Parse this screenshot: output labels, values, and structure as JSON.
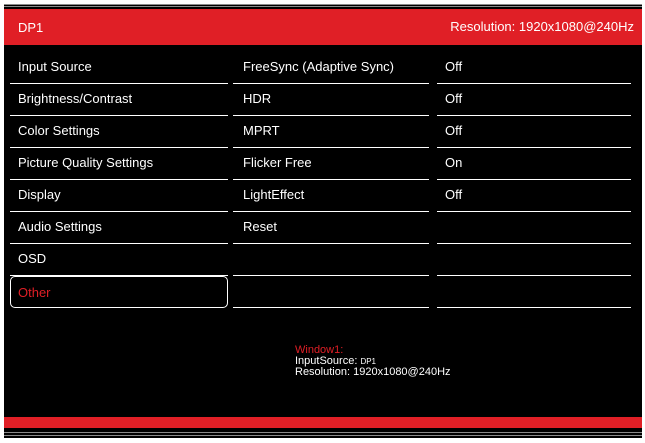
{
  "header": {
    "title": "DP1",
    "resolution": "Resolution: 1920x1080@240Hz"
  },
  "menu": {
    "items": [
      {
        "label": "Input Source"
      },
      {
        "label": "Brightness/Contrast"
      },
      {
        "label": "Color Settings"
      },
      {
        "label": "Picture Quality Settings"
      },
      {
        "label": "Display"
      },
      {
        "label": "Audio Settings"
      },
      {
        "label": "OSD"
      },
      {
        "label": "Other",
        "selected": true
      }
    ]
  },
  "submenu": {
    "items": [
      {
        "label": "FreeSync (Adaptive Sync)",
        "value": "Off"
      },
      {
        "label": "HDR",
        "value": "Off"
      },
      {
        "label": "MPRT",
        "value": "Off"
      },
      {
        "label": "Flicker Free",
        "value": "On"
      },
      {
        "label": "LightEffect",
        "value": "Off"
      },
      {
        "label": "Reset",
        "value": ""
      }
    ]
  },
  "info": {
    "window_label": "Window1:",
    "input_source_label": "InputSource:",
    "input_source_value": "DP1",
    "resolution_label": "Resolution:",
    "resolution_value": "1920x1080@240Hz"
  },
  "colors": {
    "accent": "#e01f26",
    "background": "#000000",
    "text": "#ffffff"
  }
}
